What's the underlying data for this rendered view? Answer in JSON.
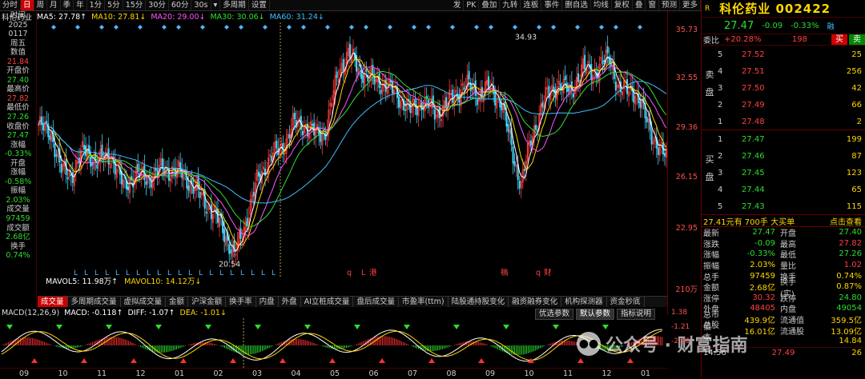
{
  "toolbar": {
    "items": [
      "分时",
      "日",
      "周",
      "月",
      "季",
      "年",
      "1分",
      "5分",
      "15分",
      "30分",
      "60分",
      "30s",
      "▾",
      "多周期",
      "设置"
    ],
    "selected": "日",
    "right": [
      "发",
      "PK",
      "叠加",
      "九转",
      "连板",
      "事件",
      "删自选",
      "均线",
      "复权",
      "叠",
      "窗",
      "预测",
      "更多"
    ]
  },
  "ma": {
    "stock": "科伦药业",
    "ma5": "MA5: 27.78↑",
    "ma10": "MA10: 27.81↓",
    "ma20": "MA20: 29.00↓",
    "ma30": "MA30: 30.06↓",
    "ma60": "MA60: 31.24↓"
  },
  "left": [
    {
      "t": "时间",
      "c": "lbl"
    },
    {
      "t": "2025",
      "c": "lbl"
    },
    {
      "t": "0117",
      "c": "lbl"
    },
    {
      "t": "周五",
      "c": "lbl"
    },
    {
      "t": "数值",
      "c": "lbl"
    },
    {
      "t": "21.84",
      "c": "red"
    },
    {
      "t": "开盘价",
      "c": "lbl"
    },
    {
      "t": "27.40",
      "c": "grn"
    },
    {
      "t": "最高价",
      "c": "lbl"
    },
    {
      "t": "27.82",
      "c": "red"
    },
    {
      "t": "最低价",
      "c": "lbl"
    },
    {
      "t": "27.26",
      "c": "grn"
    },
    {
      "t": "收盘价",
      "c": "lbl"
    },
    {
      "t": "27.47",
      "c": "grn"
    },
    {
      "t": "涨幅",
      "c": "lbl"
    },
    {
      "t": "-0.33%",
      "c": "grn"
    },
    {
      "t": "开盘",
      "c": "lbl"
    },
    {
      "t": "涨幅",
      "c": "lbl"
    },
    {
      "t": "-0.58%",
      "c": "grn"
    },
    {
      "t": "振幅",
      "c": "lbl"
    },
    {
      "t": "2.03%",
      "c": "grn"
    },
    {
      "t": "成交量",
      "c": "lbl"
    },
    {
      "t": "97459",
      "c": "grn"
    },
    {
      "t": "成交额",
      "c": "lbl"
    },
    {
      "t": "2.68亿",
      "c": "grn"
    },
    {
      "t": "换手",
      "c": "lbl"
    },
    {
      "t": "0.74%",
      "c": "grn"
    }
  ],
  "price_axis": [
    "35.73",
    "32.55",
    "29.36",
    "26.15",
    "22.95"
  ],
  "chart_data": {
    "type": "candlestick",
    "ylim": [
      19.8,
      35.73
    ],
    "high_label": "34.93",
    "low_label": "20.54",
    "markers": [
      "q",
      "L",
      "港",
      "稿",
      "q",
      "财"
    ],
    "x_ticks": [
      "09",
      "10",
      "11",
      "12",
      "01",
      "02",
      "03",
      "04",
      "05",
      "06",
      "07",
      "08",
      "09",
      "10",
      "11",
      "12",
      "01"
    ]
  },
  "vol": {
    "mavol5": "MAVOL5: 11.98万↑",
    "mavol10": "MAVOL10: 14.12万↓",
    "axis": [
      "210万"
    ]
  },
  "tabs": [
    "成交量",
    "多周期成交量",
    "虚拟成交量",
    "金额",
    "沪深金额",
    "换手率",
    "内盘",
    "外盘",
    "AI立桩成交量",
    "盘后成交量",
    "市盈率(ttm)",
    "陆股通持股变化",
    "融资融券变化",
    "机构探测器",
    "资金秒底"
  ],
  "tab_selected": "成交量",
  "macd": {
    "params": "MACD(12,26,9)",
    "macd": "MACD: -0.118↑",
    "diff": "DIFF: -1.07↑",
    "dea": "DEA: -1.01↓",
    "axis": [
      "1.38",
      "-1.21",
      "-2.90"
    ]
  },
  "opt_buttons": [
    "优选参数",
    "默认参数",
    "指标说明"
  ],
  "right": {
    "r": "R",
    "name": "科伦药业 002422",
    "price": "27.47",
    "chg": "-0.09",
    "pct": "-0.33%",
    "tag": "融",
    "wb_label": "委比",
    "wb": "+20.28%",
    "wb_num": "198",
    "buy": "买",
    "sell": "卖",
    "asks": [
      {
        "lv": "5",
        "p": "27.52",
        "v": "25"
      },
      {
        "lv": "4",
        "p": "27.51",
        "v": "256"
      },
      {
        "lv": "3",
        "p": "27.50",
        "v": "42"
      },
      {
        "lv": "2",
        "p": "27.49",
        "v": "66"
      },
      {
        "lv": "1",
        "p": "27.48",
        "v": "2"
      }
    ],
    "bids": [
      {
        "lv": "1",
        "p": "27.47",
        "v": "199"
      },
      {
        "lv": "2",
        "p": "27.46",
        "v": "87"
      },
      {
        "lv": "3",
        "p": "27.45",
        "v": "123"
      },
      {
        "lv": "4",
        "p": "27.44",
        "v": "65"
      },
      {
        "lv": "5",
        "p": "27.43",
        "v": "115"
      }
    ],
    "sell_side": "卖盘",
    "buy_side": "买盘",
    "big_order": "27.41元有 700手 大买单",
    "big_link": "点击查看",
    "details": [
      {
        "k": "最新",
        "v": "27.47",
        "vc": "grn",
        "k2": "开盘",
        "v2": "27.40",
        "v2c": "grn"
      },
      {
        "k": "涨跌",
        "v": "-0.09",
        "vc": "grn",
        "k2": "最高",
        "v2": "27.82",
        "v2c": "red"
      },
      {
        "k": "涨幅",
        "v": "-0.33%",
        "vc": "grn",
        "k2": "最低",
        "v2": "27.26",
        "v2c": "grn"
      },
      {
        "k": "振幅",
        "v": "2.03%",
        "vc": "yel",
        "k2": "量比",
        "v2": "1.02",
        "v2c": "red"
      },
      {
        "k": "总手",
        "v": "97459",
        "vc": "yel",
        "k2": "换手",
        "v2": "0.74%",
        "v2c": "yel"
      },
      {
        "k": "金额",
        "v": "2.68亿",
        "vc": "yel",
        "k2": "换手(实)",
        "v2": "0.87%",
        "v2c": "yel"
      },
      {
        "k": "涨停",
        "v": "30.32",
        "vc": "red",
        "k2": "跌停",
        "v2": "24.80",
        "v2c": "grn"
      },
      {
        "k": "外盘",
        "v": "48405",
        "vc": "red",
        "k2": "内盘",
        "v2": "49054",
        "v2c": "grn"
      },
      {
        "k": "总市值",
        "v": "439.9亿",
        "vc": "yel",
        "k2": "流通值",
        "v2": "359.5亿",
        "v2c": "yel"
      },
      {
        "k": "总股本",
        "v": "16.01亿",
        "vc": "yel",
        "k2": "流通股",
        "v2": "13.09亿",
        "v2c": "yel"
      },
      {
        "k": "",
        "v": "",
        "vc": "yel",
        "k2": "",
        "v2": "14.84",
        "v2c": "yel"
      }
    ],
    "time1": "14:56",
    "time1_p": "27.49",
    "time1_v": "6",
    "time2": "14:56",
    "time2_p": "27.49",
    "time2_v": "26"
  },
  "watermark": "公众号 · 财富指南"
}
